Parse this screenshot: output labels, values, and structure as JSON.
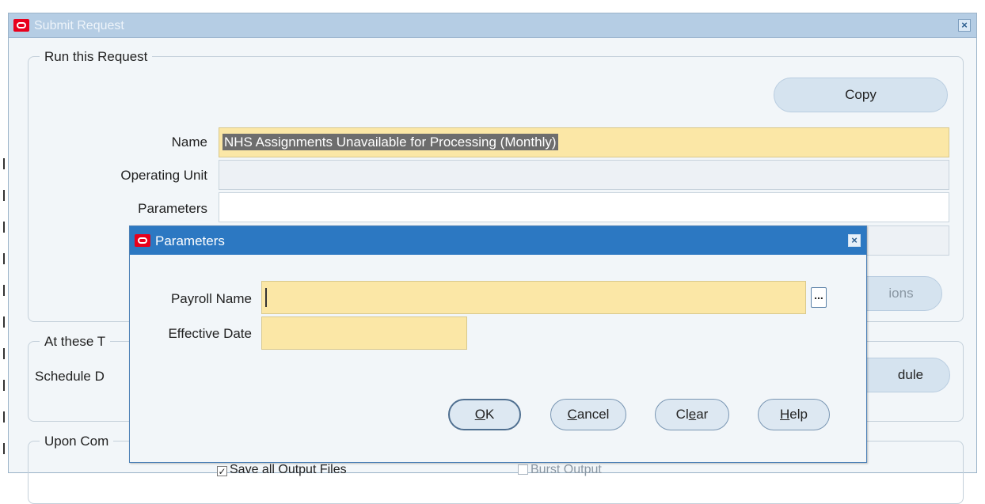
{
  "submit_request": {
    "title": "Submit Request",
    "run_group": {
      "legend": "Run this Request",
      "copy_label": "Copy",
      "name_label": "Name",
      "name_value": "NHS Assignments Unavailable for Processing (Monthly)",
      "operating_unit_label": "Operating Unit",
      "operating_unit_value": "",
      "parameters_label": "Parameters",
      "parameters_value": "",
      "options_label": "ions"
    },
    "schedule_group": {
      "legend": "At these T",
      "schedule_label": "Schedule D",
      "schedule_button_label": "dule"
    },
    "completion_group": {
      "legend": "Upon Com",
      "save_output_label": "Save all Output Files",
      "save_output_checked": true,
      "burst_output_label": "Burst Output",
      "burst_output_checked": false
    }
  },
  "parameters_dialog": {
    "title": "Parameters",
    "payroll_name_label": "Payroll Name",
    "payroll_name_value": "",
    "lov_label": "...",
    "effective_date_label": "Effective Date",
    "effective_date_value": "",
    "buttons": {
      "ok": {
        "mnemonic": "O",
        "rest": "K"
      },
      "cancel": {
        "mnemonic": "C",
        "rest": "ancel"
      },
      "clear": {
        "pre": "Cl",
        "mnemonic": "e",
        "rest": "ar"
      },
      "help": {
        "mnemonic": "H",
        "rest": "elp"
      }
    }
  },
  "icons": {
    "app_logo": "oracle-logo-icon",
    "close": "close-icon"
  },
  "colors": {
    "title_bar_active": "#2c78c2",
    "title_bar_inactive": "#b5cde4",
    "required_field": "#fbe7a6",
    "logo_red": "#e8001c"
  }
}
